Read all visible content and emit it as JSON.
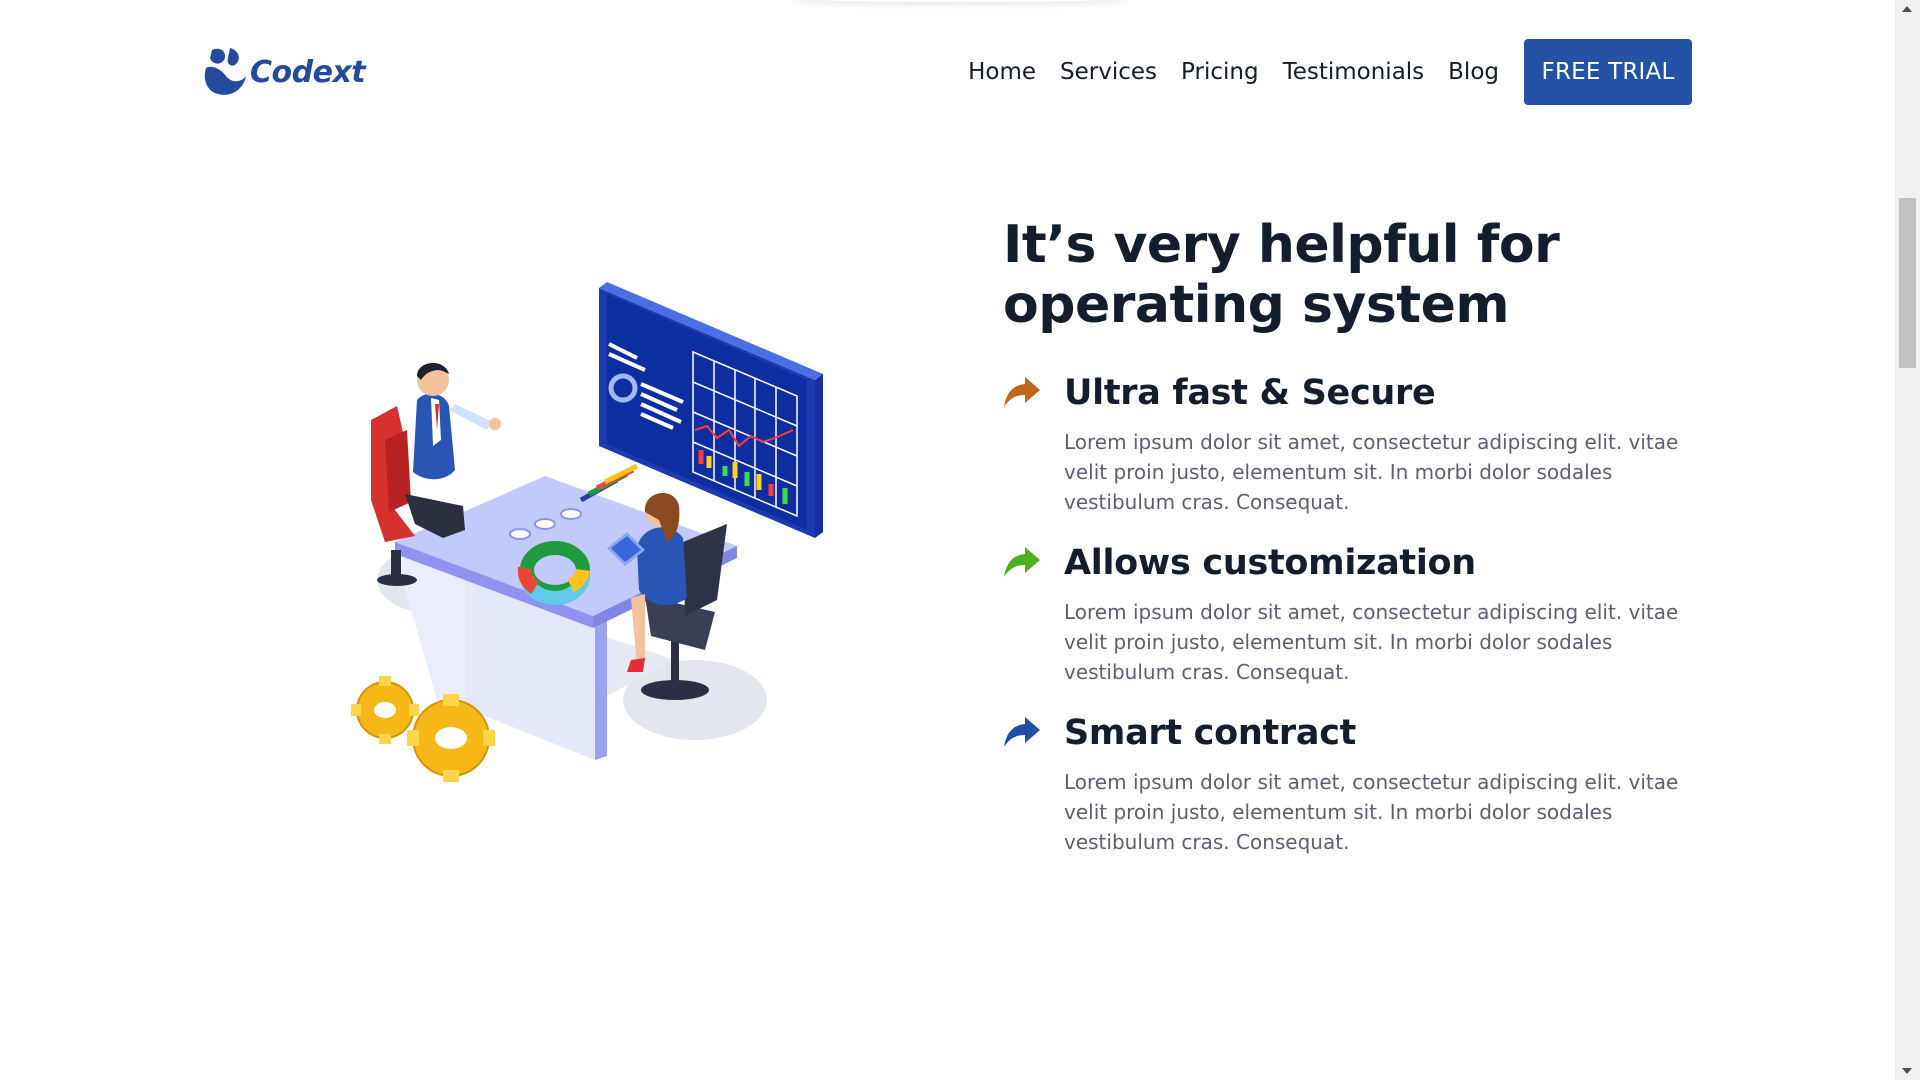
{
  "brand": {
    "name": "Codext",
    "color": "#234a9b"
  },
  "nav": {
    "items": [
      "Home",
      "Services",
      "Pricing",
      "Testimonials",
      "Blog"
    ],
    "cta_label": "FREE TRIAL",
    "cta_color": "#2453a5"
  },
  "hero": {
    "headline_line1": "It’s very helpful for",
    "headline_line2": "operating system",
    "illustration_icon": "office-workers-dashboard-illustration"
  },
  "features": [
    {
      "title": "Ultra fast & Secure",
      "description": "Lorem ipsum dolor sit amet, consectetur adipiscing elit. vitae velit proin justo, elementum sit. In morbi dolor sodales vestibulum cras. Consequat.",
      "icon": "share-arrow-icon",
      "icon_color": "#c0661d"
    },
    {
      "title": "Allows customization",
      "description": "Lorem ipsum dolor sit amet, consectetur adipiscing elit. vitae velit proin justo, elementum sit. In morbi dolor sodales vestibulum cras. Consequat.",
      "icon": "share-arrow-icon",
      "icon_color": "#4caf1e"
    },
    {
      "title": "Smart contract",
      "description": "Lorem ipsum dolor sit amet, consectetur adipiscing elit. vitae velit proin justo, elementum sit. In morbi dolor sodales vestibulum cras. Consequat.",
      "icon": "share-arrow-icon",
      "icon_color": "#1f4fa3"
    }
  ]
}
